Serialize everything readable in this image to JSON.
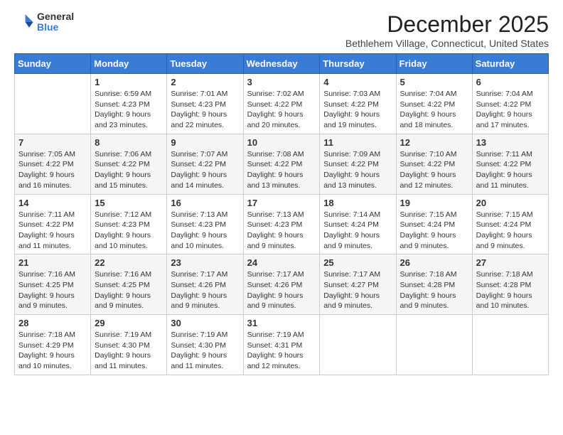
{
  "logo": {
    "general": "General",
    "blue": "Blue"
  },
  "header": {
    "title": "December 2025",
    "subtitle": "Bethlehem Village, Connecticut, United States"
  },
  "weekdays": [
    "Sunday",
    "Monday",
    "Tuesday",
    "Wednesday",
    "Thursday",
    "Friday",
    "Saturday"
  ],
  "weeks": [
    [
      {
        "day": "",
        "content": ""
      },
      {
        "day": "1",
        "content": "Sunrise: 6:59 AM\nSunset: 4:23 PM\nDaylight: 9 hours\nand 23 minutes."
      },
      {
        "day": "2",
        "content": "Sunrise: 7:01 AM\nSunset: 4:23 PM\nDaylight: 9 hours\nand 22 minutes."
      },
      {
        "day": "3",
        "content": "Sunrise: 7:02 AM\nSunset: 4:22 PM\nDaylight: 9 hours\nand 20 minutes."
      },
      {
        "day": "4",
        "content": "Sunrise: 7:03 AM\nSunset: 4:22 PM\nDaylight: 9 hours\nand 19 minutes."
      },
      {
        "day": "5",
        "content": "Sunrise: 7:04 AM\nSunset: 4:22 PM\nDaylight: 9 hours\nand 18 minutes."
      },
      {
        "day": "6",
        "content": "Sunrise: 7:04 AM\nSunset: 4:22 PM\nDaylight: 9 hours\nand 17 minutes."
      }
    ],
    [
      {
        "day": "7",
        "content": "Sunrise: 7:05 AM\nSunset: 4:22 PM\nDaylight: 9 hours\nand 16 minutes."
      },
      {
        "day": "8",
        "content": "Sunrise: 7:06 AM\nSunset: 4:22 PM\nDaylight: 9 hours\nand 15 minutes."
      },
      {
        "day": "9",
        "content": "Sunrise: 7:07 AM\nSunset: 4:22 PM\nDaylight: 9 hours\nand 14 minutes."
      },
      {
        "day": "10",
        "content": "Sunrise: 7:08 AM\nSunset: 4:22 PM\nDaylight: 9 hours\nand 13 minutes."
      },
      {
        "day": "11",
        "content": "Sunrise: 7:09 AM\nSunset: 4:22 PM\nDaylight: 9 hours\nand 13 minutes."
      },
      {
        "day": "12",
        "content": "Sunrise: 7:10 AM\nSunset: 4:22 PM\nDaylight: 9 hours\nand 12 minutes."
      },
      {
        "day": "13",
        "content": "Sunrise: 7:11 AM\nSunset: 4:22 PM\nDaylight: 9 hours\nand 11 minutes."
      }
    ],
    [
      {
        "day": "14",
        "content": "Sunrise: 7:11 AM\nSunset: 4:22 PM\nDaylight: 9 hours\nand 11 minutes."
      },
      {
        "day": "15",
        "content": "Sunrise: 7:12 AM\nSunset: 4:23 PM\nDaylight: 9 hours\nand 10 minutes."
      },
      {
        "day": "16",
        "content": "Sunrise: 7:13 AM\nSunset: 4:23 PM\nDaylight: 9 hours\nand 10 minutes."
      },
      {
        "day": "17",
        "content": "Sunrise: 7:13 AM\nSunset: 4:23 PM\nDaylight: 9 hours\nand 9 minutes."
      },
      {
        "day": "18",
        "content": "Sunrise: 7:14 AM\nSunset: 4:24 PM\nDaylight: 9 hours\nand 9 minutes."
      },
      {
        "day": "19",
        "content": "Sunrise: 7:15 AM\nSunset: 4:24 PM\nDaylight: 9 hours\nand 9 minutes."
      },
      {
        "day": "20",
        "content": "Sunrise: 7:15 AM\nSunset: 4:24 PM\nDaylight: 9 hours\nand 9 minutes."
      }
    ],
    [
      {
        "day": "21",
        "content": "Sunrise: 7:16 AM\nSunset: 4:25 PM\nDaylight: 9 hours\nand 9 minutes."
      },
      {
        "day": "22",
        "content": "Sunrise: 7:16 AM\nSunset: 4:25 PM\nDaylight: 9 hours\nand 9 minutes."
      },
      {
        "day": "23",
        "content": "Sunrise: 7:17 AM\nSunset: 4:26 PM\nDaylight: 9 hours\nand 9 minutes."
      },
      {
        "day": "24",
        "content": "Sunrise: 7:17 AM\nSunset: 4:26 PM\nDaylight: 9 hours\nand 9 minutes."
      },
      {
        "day": "25",
        "content": "Sunrise: 7:17 AM\nSunset: 4:27 PM\nDaylight: 9 hours\nand 9 minutes."
      },
      {
        "day": "26",
        "content": "Sunrise: 7:18 AM\nSunset: 4:28 PM\nDaylight: 9 hours\nand 9 minutes."
      },
      {
        "day": "27",
        "content": "Sunrise: 7:18 AM\nSunset: 4:28 PM\nDaylight: 9 hours\nand 10 minutes."
      }
    ],
    [
      {
        "day": "28",
        "content": "Sunrise: 7:18 AM\nSunset: 4:29 PM\nDaylight: 9 hours\nand 10 minutes."
      },
      {
        "day": "29",
        "content": "Sunrise: 7:19 AM\nSunset: 4:30 PM\nDaylight: 9 hours\nand 11 minutes."
      },
      {
        "day": "30",
        "content": "Sunrise: 7:19 AM\nSunset: 4:30 PM\nDaylight: 9 hours\nand 11 minutes."
      },
      {
        "day": "31",
        "content": "Sunrise: 7:19 AM\nSunset: 4:31 PM\nDaylight: 9 hours\nand 12 minutes."
      },
      {
        "day": "",
        "content": ""
      },
      {
        "day": "",
        "content": ""
      },
      {
        "day": "",
        "content": ""
      }
    ]
  ]
}
